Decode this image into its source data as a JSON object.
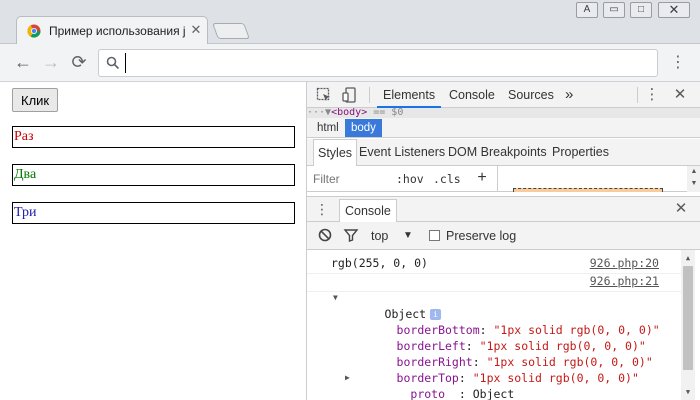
{
  "window": {
    "tab_title": "Пример использования jQuery",
    "user_button": "A",
    "minimize": "▭",
    "maximize": "□",
    "close": "✕"
  },
  "toolbar": {
    "back": "←",
    "forward": "→",
    "reload": "⟳",
    "omnibox_value": "",
    "menu": "⋮"
  },
  "page": {
    "button_label": "Клик",
    "inputs": [
      {
        "value": "Раз",
        "color": "#cc0000"
      },
      {
        "value": "Два",
        "color": "#007a00"
      },
      {
        "value": "Три",
        "color": "#1a1aa6"
      }
    ]
  },
  "devtools": {
    "tabs": {
      "elements": "Elements",
      "console": "Console",
      "sources": "Sources",
      "more": "»"
    },
    "crumb_line": {
      "prefix": "···▼",
      "tag": "<body>",
      "suffix": " == $0"
    },
    "breadcrumbs": {
      "html": "html",
      "body": "body"
    },
    "styles_tabs": {
      "styles": "Styles",
      "event_listeners": "Event Listeners",
      "dom_breakpoints": "DOM Breakpoints",
      "properties": "Properties"
    },
    "filter": {
      "placeholder": "Filter",
      "hov": ":hov",
      "cls": ".cls",
      "plus": "+"
    },
    "drawer": {
      "tab": "Console"
    },
    "console_toolbar": {
      "context": "top",
      "preserve_log": "Preserve log"
    },
    "console": {
      "line1": {
        "text": "rgb(255, 0, 0)",
        "source": "926.php:20"
      },
      "line2": {
        "source": "926.php:21"
      },
      "object_label": "Object",
      "info_badge": "i",
      "props": [
        {
          "key": "borderBottom",
          "value": "\"1px solid rgb(0, 0, 0)\""
        },
        {
          "key": "borderLeft",
          "value": "\"1px solid rgb(0, 0, 0)\""
        },
        {
          "key": "borderRight",
          "value": "\"1px solid rgb(0, 0, 0)\""
        },
        {
          "key": "borderTop",
          "value": "\"1px solid rgb(0, 0, 0)\""
        }
      ],
      "proto_key": "__proto__",
      "proto_value": "Object"
    }
  }
}
